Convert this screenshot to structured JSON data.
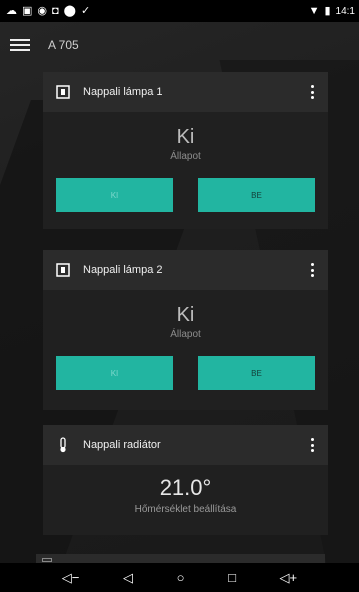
{
  "status_bar": {
    "time": "14:1",
    "left_icons": [
      "cloud-icon",
      "image-icon",
      "circle-icon",
      "box-icon",
      "shield-icon",
      "check-icon"
    ],
    "right_icons": [
      "wifi-icon",
      "battery-icon"
    ]
  },
  "app_bar": {
    "title": "A 705"
  },
  "cards": [
    {
      "title": "Nappali lámpa 1",
      "state_value": "Ki",
      "state_label": "Állapot",
      "off_label": "KI",
      "on_label": "BE"
    },
    {
      "title": "Nappali lámpa 2",
      "state_value": "Ki",
      "state_label": "Állapot",
      "off_label": "KI",
      "on_label": "BE"
    },
    {
      "title": "Nappali radiátor",
      "value": "21.0°",
      "label": "Hőmérséklet beállítása"
    }
  ],
  "nav_bar": {
    "icons": [
      "volume-down-icon",
      "back-icon",
      "home-icon",
      "recents-icon",
      "volume-up-icon"
    ]
  },
  "colors": {
    "accent": "#22b5a1",
    "card_header": "#2b2b2b",
    "card_body": "#202020"
  }
}
